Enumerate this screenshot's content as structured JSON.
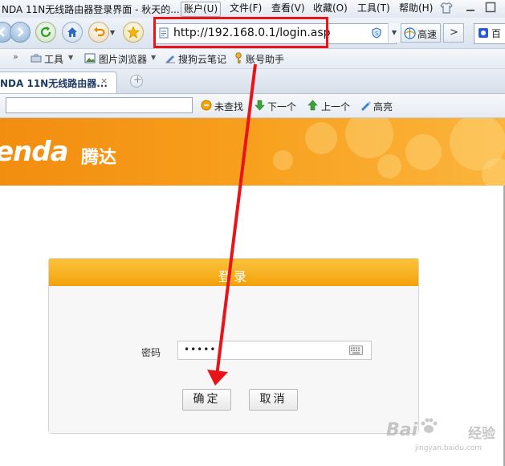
{
  "window": {
    "title": "NDA 11N无线路由器登录界面 - 秋天的..."
  },
  "menu": [
    "账户(U)",
    "文件(F)",
    "查看(V)",
    "收藏(O)",
    "工具(T)",
    "帮助(H)"
  ],
  "address_bar": {
    "url": "http://192.168.0.1/login.asp",
    "speed_label": "高速",
    "search_engine_label": "百"
  },
  "favorites_bar": {
    "items": [
      "工具",
      "图片浏览器",
      "搜狗云笔记",
      "账号助手"
    ]
  },
  "tab": {
    "label": "NDA 11N无线路由器...",
    "close_glyph": "×",
    "new_tab_glyph": "+"
  },
  "find_bar": {
    "input_value": "",
    "not_found": "未查找",
    "next": "下一个",
    "prev": "上一个",
    "highlight": "高亮"
  },
  "page": {
    "logo_text": "enda",
    "logo_cn": "腾达",
    "login": {
      "title": "登录",
      "password_label": "密码",
      "password_value": "•••••",
      "confirm_label": "确定",
      "cancel_label": "取消"
    }
  },
  "watermark": {
    "text": "Bai",
    "cn": "经验",
    "url": "jingyan.baidu.com"
  },
  "colors": {
    "highlight_red": "#e8141a",
    "banner_orange": "#f5951a",
    "login_header": "#f5ab1a"
  },
  "icons": [
    "back-icon",
    "forward-icon",
    "refresh-icon",
    "home-icon",
    "undo-icon",
    "star-icon",
    "page-icon",
    "shield-icon",
    "speed-icon",
    "search-engine-icon",
    "keyboard-icon"
  ]
}
